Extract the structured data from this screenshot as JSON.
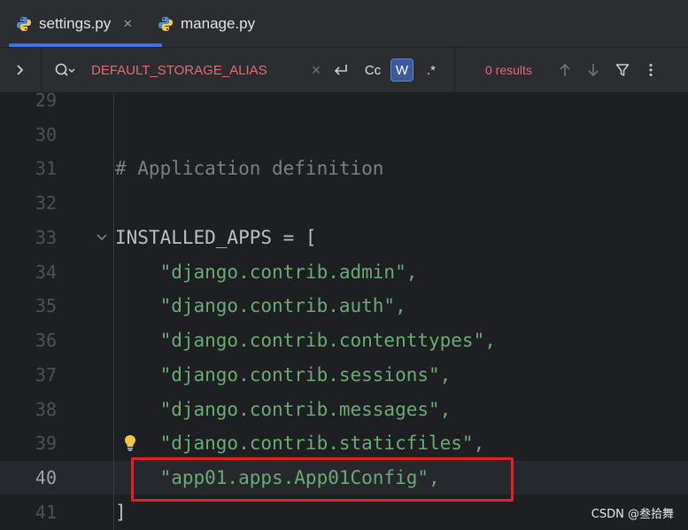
{
  "tabs": [
    {
      "label": "settings.py",
      "close": "×",
      "active": true
    },
    {
      "label": "manage.py",
      "active": false
    }
  ],
  "find_bar": {
    "query": "DEFAULT_STORAGE_ALIAS",
    "clear_glyph": "×",
    "match_case_label": "Cc",
    "words_label": "W",
    "regex_label": ".*",
    "results": "0 results"
  },
  "editor": {
    "lines": [
      {
        "number": "29",
        "text": ""
      },
      {
        "number": "30",
        "text": ""
      },
      {
        "number": "31",
        "text": "# Application definition"
      },
      {
        "number": "32",
        "text": ""
      },
      {
        "number": "33",
        "text": "INSTALLED_APPS = ["
      },
      {
        "number": "34",
        "text": "    \"django.contrib.admin\","
      },
      {
        "number": "35",
        "text": "    \"django.contrib.auth\","
      },
      {
        "number": "36",
        "text": "    \"django.contrib.contenttypes\","
      },
      {
        "number": "37",
        "text": "    \"django.contrib.sessions\","
      },
      {
        "number": "38",
        "text": "    \"django.contrib.messages\","
      },
      {
        "number": "39",
        "text": "    \"django.contrib.staticfiles\","
      },
      {
        "number": "40",
        "text": "    \"app01.apps.App01Config\","
      },
      {
        "number": "41",
        "text": "]"
      }
    ],
    "current_line": "40"
  },
  "watermark": "CSDN @叁拾舞",
  "colors": {
    "accent": "#3574f0",
    "string": "#6aab73",
    "comment": "#7a7e85",
    "highlight_box": "#e0202a",
    "find_text": "#e06c75"
  }
}
